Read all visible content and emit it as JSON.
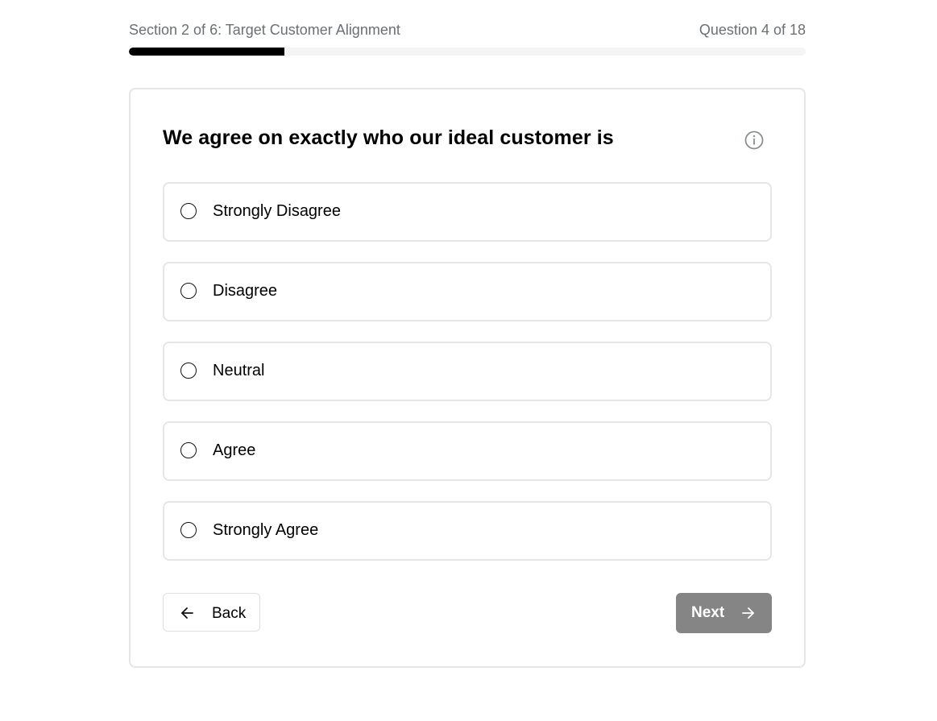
{
  "header": {
    "section_label": "Section 2 of 6: Target Customer Alignment",
    "question_counter": "Question 4 of 18",
    "progress_fraction": 0.23
  },
  "question": {
    "text": "We agree on exactly who our ideal customer is",
    "info_icon": "info-circle-icon"
  },
  "options": [
    {
      "label": "Strongly Disagree",
      "selected": false
    },
    {
      "label": "Disagree",
      "selected": false
    },
    {
      "label": "Neutral",
      "selected": false
    },
    {
      "label": "Agree",
      "selected": false
    },
    {
      "label": "Strongly Agree",
      "selected": false
    }
  ],
  "nav": {
    "back_label": "Back",
    "back_icon": "arrow-left-icon",
    "next_label": "Next",
    "next_icon": "arrow-right-icon",
    "next_disabled": true
  },
  "colors": {
    "progress_fill": "#000000",
    "progress_track": "#f4f4f4",
    "next_disabled_bg": "#858585",
    "muted_text": "#6b7075"
  }
}
